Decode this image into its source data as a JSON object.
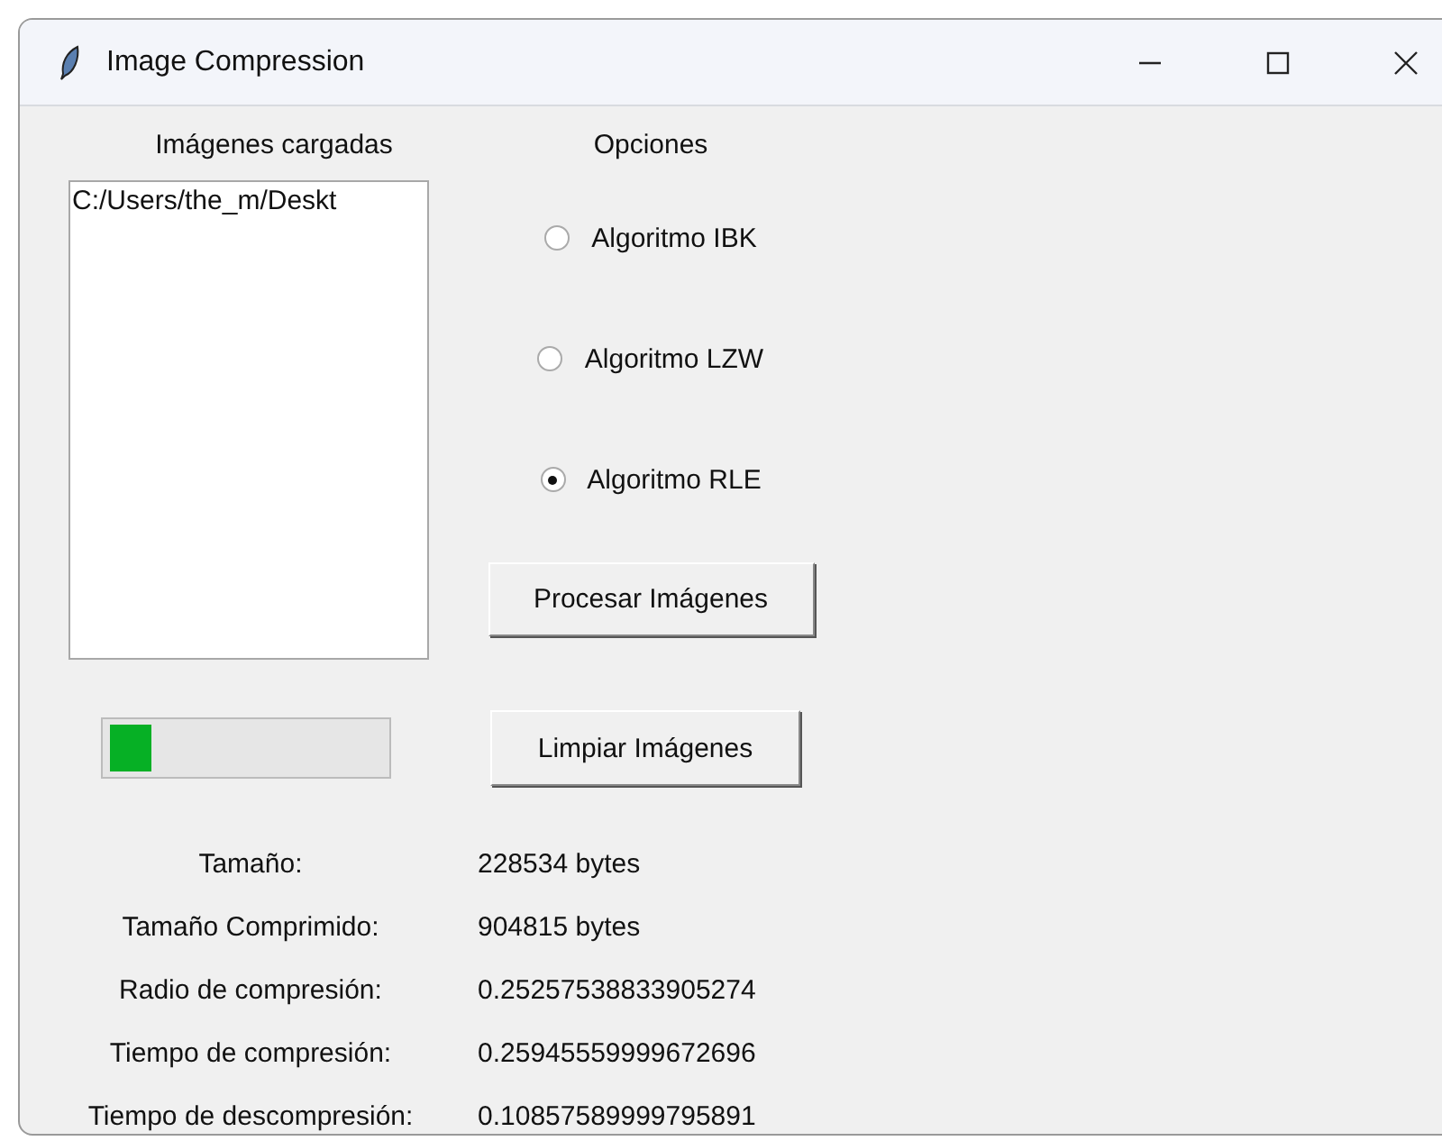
{
  "window": {
    "title": "Image Compression"
  },
  "images": {
    "label": "Imágenes cargadas",
    "items": [
      "C:/Users/the_m/Deskt"
    ]
  },
  "options": {
    "label": "Opciones",
    "radios": [
      {
        "label": "Algoritmo IBK",
        "selected": false
      },
      {
        "label": "Algoritmo LZW",
        "selected": false
      },
      {
        "label": "Algoritmo RLE",
        "selected": true
      }
    ]
  },
  "process_button": "Procesar Imágenes",
  "progress": {
    "level": 0.15
  },
  "clear_button": "Limpiar Imágenes",
  "stats": [
    {
      "label": "Tamaño:",
      "value": "228534 bytes"
    },
    {
      "label": "Tamaño Comprimido:",
      "value": "904815 bytes"
    },
    {
      "label": "Radio de compresión:",
      "value": "0.25257538833905274"
    },
    {
      "label": "Tiempo de compresión:",
      "value": "0.25945559999672696"
    },
    {
      "label": "Tiempo de descompresión:",
      "value": "0.10857589999795891"
    }
  ]
}
